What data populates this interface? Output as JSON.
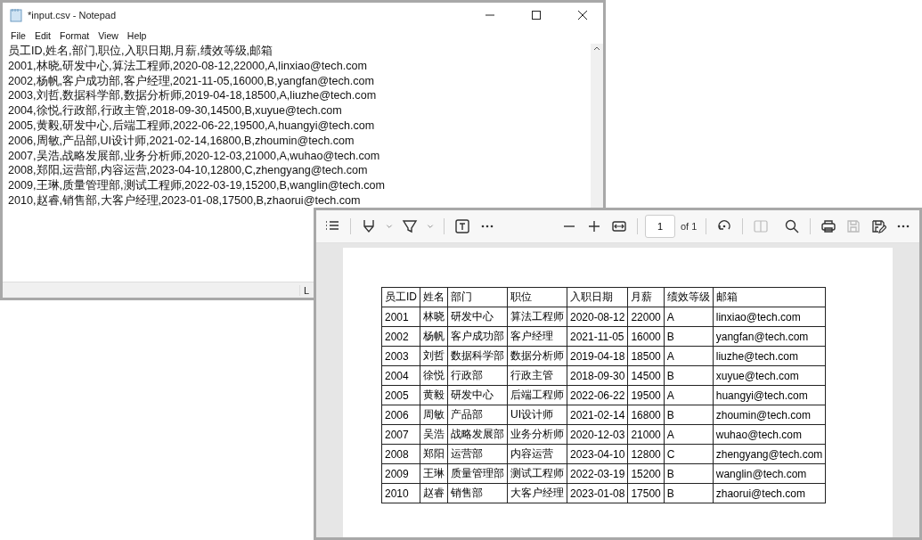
{
  "notepad": {
    "title": "*input.csv - Notepad",
    "menu": [
      "File",
      "Edit",
      "Format",
      "View",
      "Help"
    ],
    "lines": [
      "员工ID,姓名,部门,职位,入职日期,月薪,绩效等级,邮箱",
      "2001,林晓,研发中心,算法工程师,2020-08-12,22000,A,linxiao@tech.com",
      "2002,杨帆,客户成功部,客户经理,2021-11-05,16000,B,yangfan@tech.com",
      "2003,刘哲,数据科学部,数据分析师,2019-04-18,18500,A,liuzhe@tech.com",
      "2004,徐悦,行政部,行政主管,2018-09-30,14500,B,xuyue@tech.com",
      "2005,黄毅,研发中心,后端工程师,2022-06-22,19500,A,huangyi@tech.com",
      "2006,周敏,产品部,UI设计师,2021-02-14,16800,B,zhoumin@tech.com",
      "2007,吴浩,战略发展部,业务分析师,2020-12-03,21000,A,wuhao@tech.com",
      "2008,郑阳,运营部,内容运营,2023-04-10,12800,C,zhengyang@tech.com",
      "2009,王琳,质量管理部,测试工程师,2022-03-19,15200,B,wanglin@tech.com",
      "2010,赵睿,销售部,大客户经理,2023-01-08,17500,B,zhaorui@tech.com"
    ],
    "status_text": "L"
  },
  "pdf_viewer": {
    "toolbar": {
      "tools": [
        {
          "kind": "list",
          "disabled": false
        },
        {
          "kind": "sep"
        },
        {
          "kind": "draw",
          "disabled": false
        },
        {
          "kind": "chevron",
          "disabled": false
        },
        {
          "kind": "highlight",
          "disabled": false
        },
        {
          "kind": "chevron",
          "disabled": false
        },
        {
          "kind": "sep"
        },
        {
          "kind": "textbox",
          "disabled": false
        },
        {
          "kind": "more",
          "disabled": false
        },
        {
          "kind": "gap"
        },
        {
          "kind": "minus",
          "disabled": false
        },
        {
          "kind": "plus",
          "disabled": false
        },
        {
          "kind": "fit",
          "disabled": false
        },
        {
          "kind": "sep"
        },
        {
          "kind": "page"
        },
        {
          "kind": "sep"
        },
        {
          "kind": "rotate",
          "disabled": false
        },
        {
          "kind": "sep"
        },
        {
          "kind": "twopage",
          "disabled": true
        },
        {
          "kind": "gap"
        },
        {
          "kind": "search",
          "disabled": false
        },
        {
          "kind": "sep"
        },
        {
          "kind": "print",
          "disabled": false
        },
        {
          "kind": "save",
          "disabled": true
        },
        {
          "kind": "saveas",
          "disabled": false
        },
        {
          "kind": "more",
          "disabled": false
        }
      ],
      "page_input": "1",
      "page_total": "of 1"
    },
    "table": {
      "columns": [
        "员工ID",
        "姓名",
        "部门",
        "职位",
        "入职日期",
        "月薪",
        "绩效等级",
        "邮箱"
      ],
      "rows": [
        [
          "2001",
          "林晓",
          "研发中心",
          "算法工程师",
          "2020-08-12",
          "22000",
          "A",
          "linxiao@tech.com"
        ],
        [
          "2002",
          "杨帆",
          "客户成功部",
          "客户经理",
          "2021-11-05",
          "16000",
          "B",
          "yangfan@tech.com"
        ],
        [
          "2003",
          "刘哲",
          "数据科学部",
          "数据分析师",
          "2019-04-18",
          "18500",
          "A",
          "liuzhe@tech.com"
        ],
        [
          "2004",
          "徐悦",
          "行政部",
          "行政主管",
          "2018-09-30",
          "14500",
          "B",
          "xuyue@tech.com"
        ],
        [
          "2005",
          "黄毅",
          "研发中心",
          "后端工程师",
          "2022-06-22",
          "19500",
          "A",
          "huangyi@tech.com"
        ],
        [
          "2006",
          "周敏",
          "产品部",
          "UI设计师",
          "2021-02-14",
          "16800",
          "B",
          "zhoumin@tech.com"
        ],
        [
          "2007",
          "吴浩",
          "战略发展部",
          "业务分析师",
          "2020-12-03",
          "21000",
          "A",
          "wuhao@tech.com"
        ],
        [
          "2008",
          "郑阳",
          "运营部",
          "内容运营",
          "2023-04-10",
          "12800",
          "C",
          "zhengyang@tech.com"
        ],
        [
          "2009",
          "王琳",
          "质量管理部",
          "测试工程师",
          "2022-03-19",
          "15200",
          "B",
          "wanglin@tech.com"
        ],
        [
          "2010",
          "赵睿",
          "销售部",
          "大客户经理",
          "2023-01-08",
          "17500",
          "B",
          "zhaorui@tech.com"
        ]
      ]
    }
  }
}
